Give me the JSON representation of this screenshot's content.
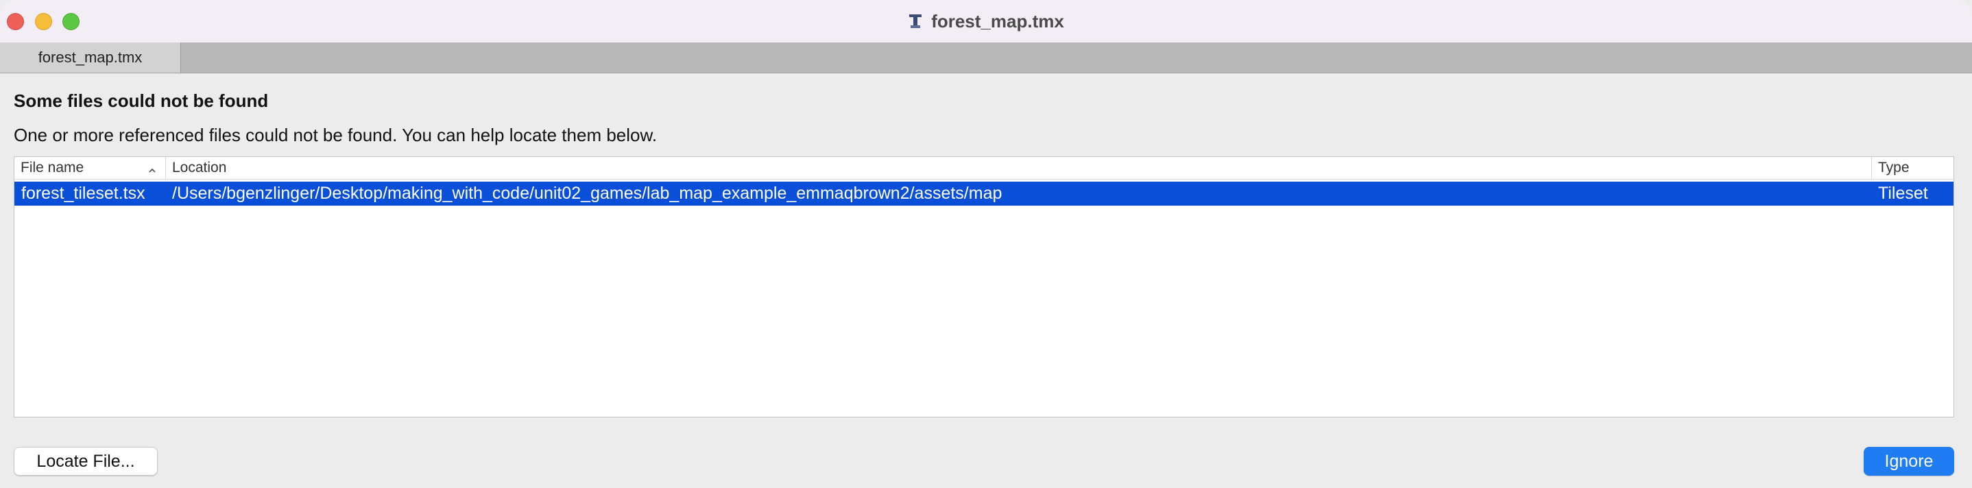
{
  "window": {
    "title": "forest_map.tmx",
    "title_icon": "tiled-app-icon"
  },
  "tabs": [
    {
      "label": "forest_map.tmx"
    }
  ],
  "dialog": {
    "heading": "Some files could not be found",
    "description": "One or more referenced files could not be found. You can help locate them below.",
    "table": {
      "columns": [
        {
          "label": "File name",
          "sort": "ascending"
        },
        {
          "label": "Location"
        },
        {
          "label": "Type"
        }
      ],
      "rows": [
        {
          "file_name": "forest_tileset.tsx",
          "location": "/Users/bgenzlinger/Desktop/making_with_code/unit02_games/lab_map_example_emmaqbrown2/assets/map",
          "type": "Tileset",
          "selected": true
        }
      ]
    },
    "buttons": {
      "locate": "Locate File...",
      "ignore": "Ignore"
    }
  },
  "colors": {
    "selection": "#0a4fd8",
    "primary_button": "#1f7cf3",
    "close": "#ee5f58",
    "minimize": "#f6bd3b",
    "maximize": "#5cc844"
  }
}
